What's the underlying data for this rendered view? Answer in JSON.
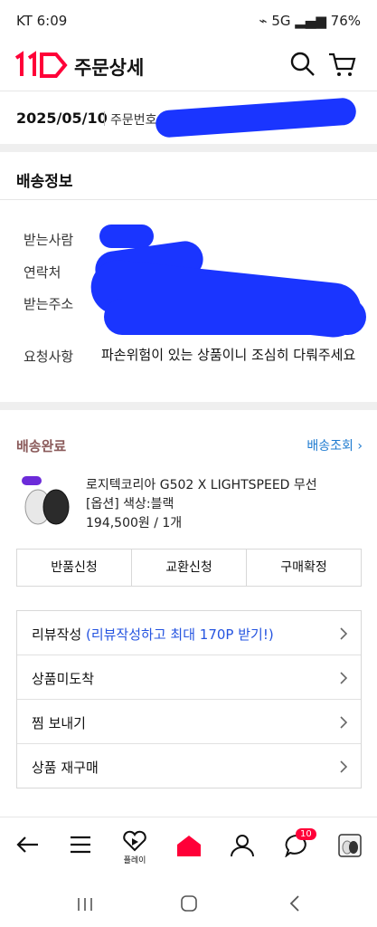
{
  "status": {
    "time": "KT 6:09",
    "battery": "76%"
  },
  "header": {
    "title": "주문상세"
  },
  "order": {
    "date": "2025/05/10",
    "number_label": "주문번호"
  },
  "shipping": {
    "title": "배송정보",
    "recipient_label": "받는사람",
    "contact_label": "연락처",
    "address_label": "받는주소",
    "request_label": "요청사항",
    "request_value": "파손위험이 있는 상품이니 조심히 다뤄주세요"
  },
  "delivery": {
    "status": "배송완료",
    "track_label": "배송조회",
    "product_name": "로지텍코리아 G502 X LIGHTSPEED 무선",
    "product_option": "[옵션] 색상:블랙",
    "product_price": "194,500원 / 1개",
    "buttons": [
      "반품신청",
      "교환신청",
      "구매확정"
    ]
  },
  "menu": {
    "review": "리뷰작성",
    "review_promo": "(리뷰작성하고 최대 170P 받기!)",
    "not_received": "상품미도착",
    "share_wish": "찜 보내기",
    "rebuy": "상품 재구매"
  },
  "bottom_nav": {
    "play_label": "플레이",
    "notification_count": "10"
  },
  "colors": {
    "brand": "#ff0038",
    "link": "#1e7bd0",
    "redaction": "#1a35ff"
  }
}
